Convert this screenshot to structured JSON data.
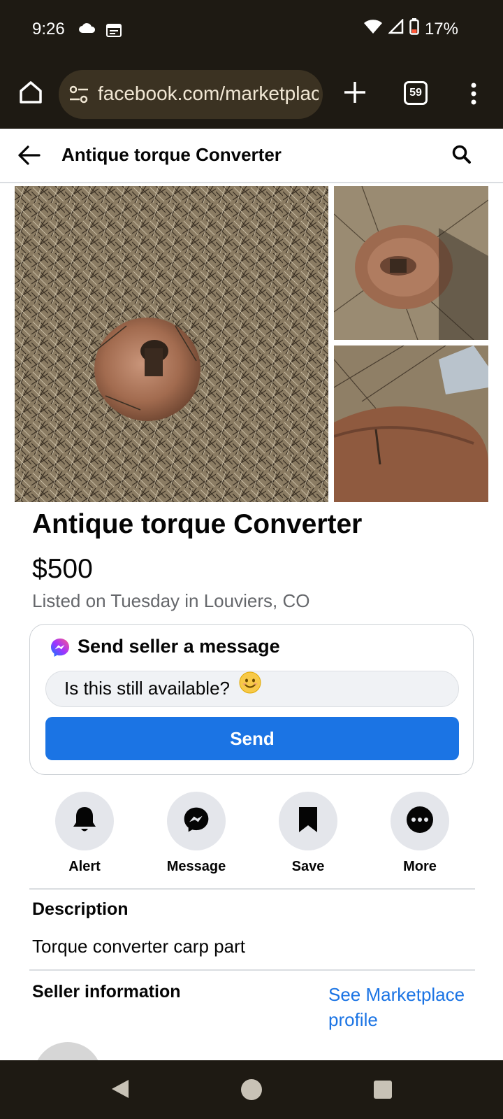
{
  "status_bar": {
    "time": "9:26",
    "battery": "17%"
  },
  "browser": {
    "url": "facebook.com/marketplace",
    "tab_count": "59"
  },
  "header": {
    "title": "Antique torque Converter"
  },
  "listing": {
    "title": "Antique torque Converter",
    "price": "$500",
    "listed": "Listed on Tuesday in Louviers, CO"
  },
  "message_card": {
    "title": "Send seller a message",
    "input_value": "Is this still available?",
    "send_label": "Send"
  },
  "actions": [
    {
      "label": "Alert",
      "icon": "bell-icon"
    },
    {
      "label": "Message",
      "icon": "messenger-icon"
    },
    {
      "label": "Save",
      "icon": "bookmark-icon"
    },
    {
      "label": "More",
      "icon": "more-icon"
    }
  ],
  "description": {
    "heading": "Description",
    "text": "Torque converter carp part"
  },
  "seller": {
    "heading": "Seller information",
    "link": "See Marketplace profile"
  },
  "colors": {
    "accent": "#1b74e4",
    "chrome": "#1e1a13",
    "urlbar": "#3b3222"
  }
}
